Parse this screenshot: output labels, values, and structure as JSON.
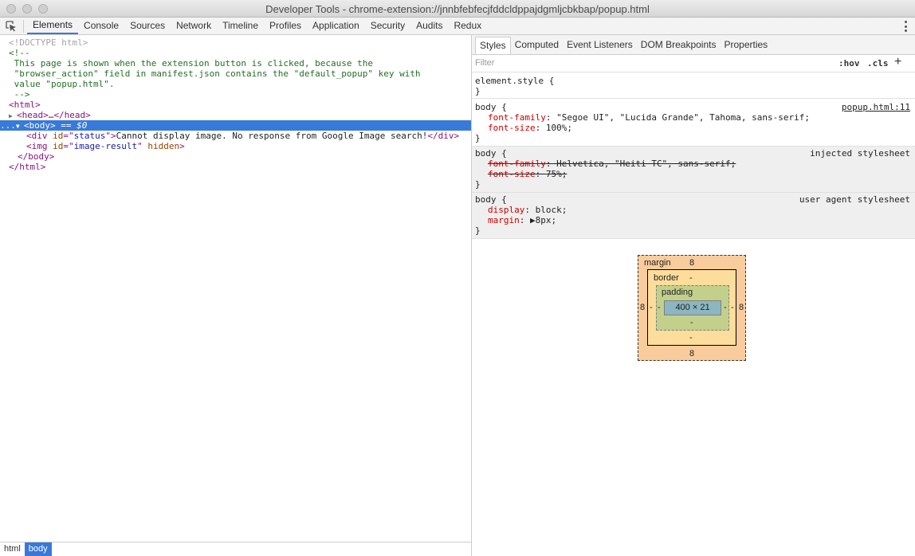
{
  "window": {
    "title": "Developer Tools - chrome-extension://jnnbfebfecjfddcldppajdgmljcbkbap/popup.html"
  },
  "toolbar": {
    "tabs": [
      "Elements",
      "Console",
      "Sources",
      "Network",
      "Timeline",
      "Profiles",
      "Application",
      "Security",
      "Audits",
      "Redux"
    ],
    "active_tab": "Elements"
  },
  "dom": {
    "doctype": "<!DOCTYPE html>",
    "comment_open": "<!--",
    "comment_lines": [
      " This page is shown when the extension button is clicked, because the",
      " \"browser_action\" field in manifest.json contains the \"default_popup\" key with",
      " value \"popup.html\".",
      " -->"
    ],
    "html_open": "<html>",
    "head_line": "<head>…</head>",
    "body_open": "<body>",
    "body_suffix": " == $0",
    "div_line": {
      "open": "<div ",
      "attr": "id",
      "eq": "=\"",
      "value": "status",
      "close": "\">",
      "text": "Cannot display image. No response from Google Image search!",
      "end": "</div>"
    },
    "img_line": {
      "open": "<img ",
      "attr": "id",
      "eq": "=\"",
      "value": "image-result",
      "close": "\" ",
      "attr2": "hidden",
      "end": ">"
    },
    "body_close": "</body>",
    "html_close": "</html>",
    "selected_prefix": "..."
  },
  "breadcrumbs": [
    "html",
    "body"
  ],
  "styles_panel": {
    "tabs": [
      "Styles",
      "Computed",
      "Event Listeners",
      "DOM Breakpoints",
      "Properties"
    ],
    "active_tab": "Styles",
    "filter_placeholder": "Filter",
    "hov": ":hov",
    "cls": ".cls",
    "add": "+",
    "element_style": {
      "selector": "element.style {",
      "close": "}"
    },
    "rules": [
      {
        "selector": "body {",
        "source": "popup.html:11",
        "properties": [
          {
            "name": "font-family",
            "value": "\"Segoe UI\", \"Lucida Grande\", Tahoma, sans-serif;",
            "struck": false
          },
          {
            "name": "font-size",
            "value": "100%;",
            "struck": false
          }
        ],
        "close": "}"
      },
      {
        "selector": "body {",
        "source": "injected stylesheet",
        "properties": [
          {
            "name": "font-family",
            "value": "Helvetica, \"Heiti TC\", sans-serif;",
            "struck": true
          },
          {
            "name": "font-size",
            "value": "75%;",
            "struck": true
          }
        ],
        "close": "}"
      },
      {
        "selector": "body {",
        "source": "user agent stylesheet",
        "properties": [
          {
            "name": "display",
            "value": "block;",
            "struck": false
          },
          {
            "name": "margin",
            "value": "▶8px;",
            "struck": false
          }
        ],
        "close": "}"
      }
    ]
  },
  "box_model": {
    "margin_label": "margin",
    "margin_top": "8",
    "margin_bottom": "8",
    "margin_left": "8",
    "margin_right": "8",
    "border_label": "border",
    "border_top": "-",
    "border_bottom": "-",
    "border_left": "-",
    "border_right": "-",
    "padding_label": "padding",
    "padding_top": "",
    "padding_bottom": "-",
    "padding_left": "-",
    "padding_right": "-",
    "content": "400 × 21"
  },
  "colors": {
    "accent": "#3879d9",
    "margin": "#f9cc9d",
    "border": "#fddd9b",
    "padding": "#c3d08b",
    "content": "#8cb6c0"
  }
}
